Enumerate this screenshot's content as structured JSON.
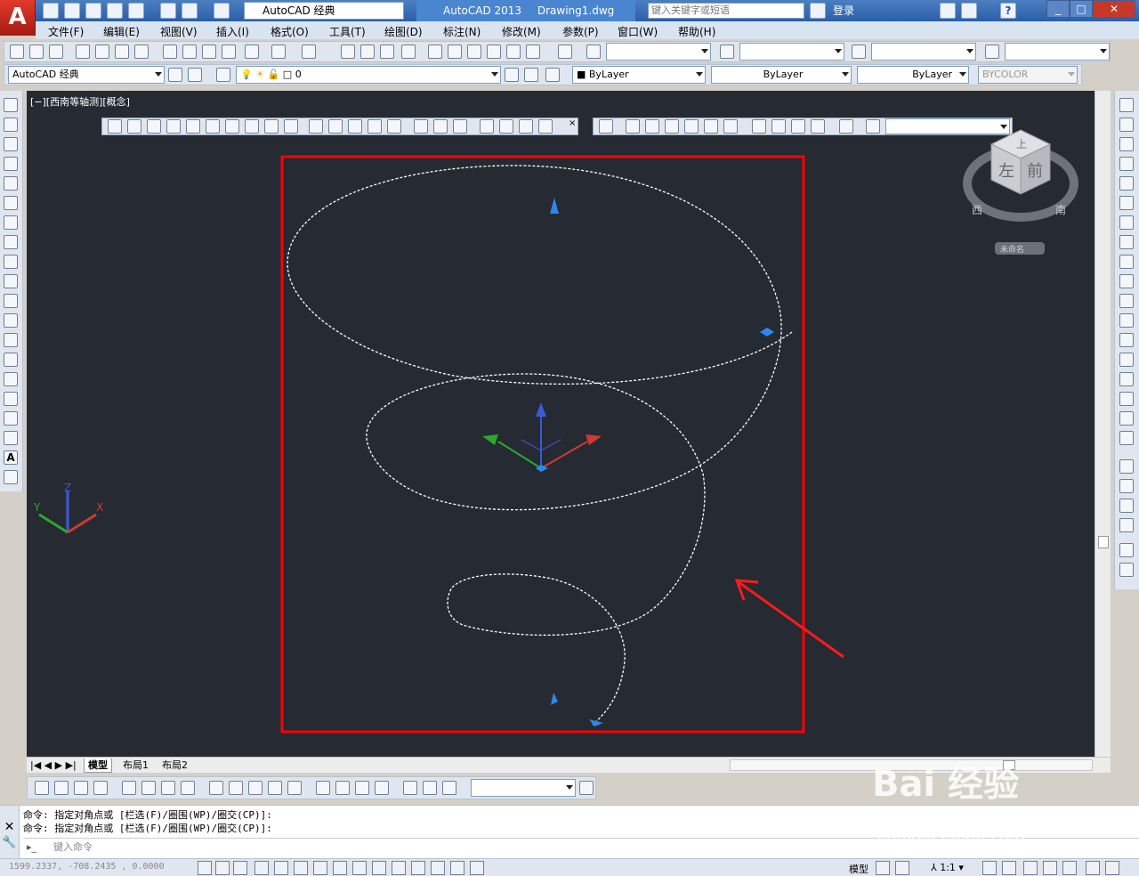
{
  "titlebar": {
    "workspace": "AutoCAD 经典",
    "app_title": "AutoCAD 2013",
    "doc_name": "Drawing1.dwg",
    "search_placeholder": "键入关键字或短语",
    "login_label": "登录",
    "help_label": "?"
  },
  "menu": [
    "文件(F)",
    "编辑(E)",
    "视图(V)",
    "插入(I)",
    "格式(O)",
    "工具(T)",
    "绘图(D)",
    "标注(N)",
    "修改(M)",
    "参数(P)",
    "窗口(W)",
    "帮助(H)"
  ],
  "props": {
    "workspace2": "AutoCAD 经典",
    "layer": "0",
    "color": "ByLayer",
    "linetype": "ByLayer",
    "lineweight": "ByLayer",
    "plotstyle": "BYCOLOR"
  },
  "viewport": {
    "label": "[−][西南等轴测][概念]",
    "viewcube": {
      "top": "上",
      "left": "左",
      "front": "前",
      "west": "西",
      "south": "南",
      "unnamed": "未命名"
    },
    "ucs": {
      "x": "X",
      "y": "Y",
      "z": "Z"
    }
  },
  "tabs": [
    "模型",
    "布局1",
    "布局2"
  ],
  "command": {
    "line1": "命令: 指定对角点或 [栏选(F)/圈围(WP)/圈交(CP)]:",
    "line2": "命令: 指定对角点或 [栏选(F)/圈围(WP)/圈交(CP)]:",
    "input_placeholder": "键入命令"
  },
  "status": {
    "coords": "1599.2337, -708.2435 , 0.0000",
    "model_label": "模型",
    "scale": "1:1"
  },
  "watermark": {
    "brand": "Bai 经验",
    "url": "jingyan.baidu.com"
  },
  "colors": {
    "highlight": "#ff0000",
    "canvas": "#252a33",
    "grip": "#1e88ff"
  }
}
